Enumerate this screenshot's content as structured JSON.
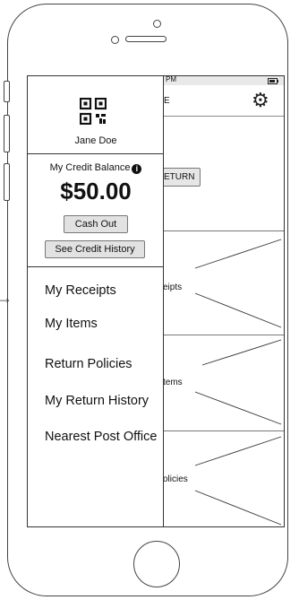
{
  "status": {
    "time_fragment": "PM"
  },
  "appbar": {
    "title_fragment": "E"
  },
  "main": {
    "return_button_fragment": "ETURN",
    "section_labels": [
      "eipts",
      "tems",
      "olicies"
    ]
  },
  "drawer": {
    "user_name": "Jane Doe",
    "balance_label": "My Credit Balance",
    "info_icon_glyph": "i",
    "balance_amount": "$50.00",
    "cash_out_label": "Cash Out",
    "credit_history_label": "See Credit History",
    "menu": [
      {
        "label": "My Receipts"
      },
      {
        "label": "My Items"
      },
      {
        "label": "Return Policies"
      },
      {
        "label": "My Return History"
      },
      {
        "label": "Nearest Post Office"
      }
    ]
  },
  "icons": {
    "gear": "gear-icon",
    "qr": "qr-code-icon",
    "info": "info-icon",
    "battery": "battery-icon",
    "arrow": "arrow-right-icon"
  },
  "colors": {
    "frame": "#444444",
    "status_bar": "#e9e9e9",
    "button_bg": "#e2e2e2"
  }
}
